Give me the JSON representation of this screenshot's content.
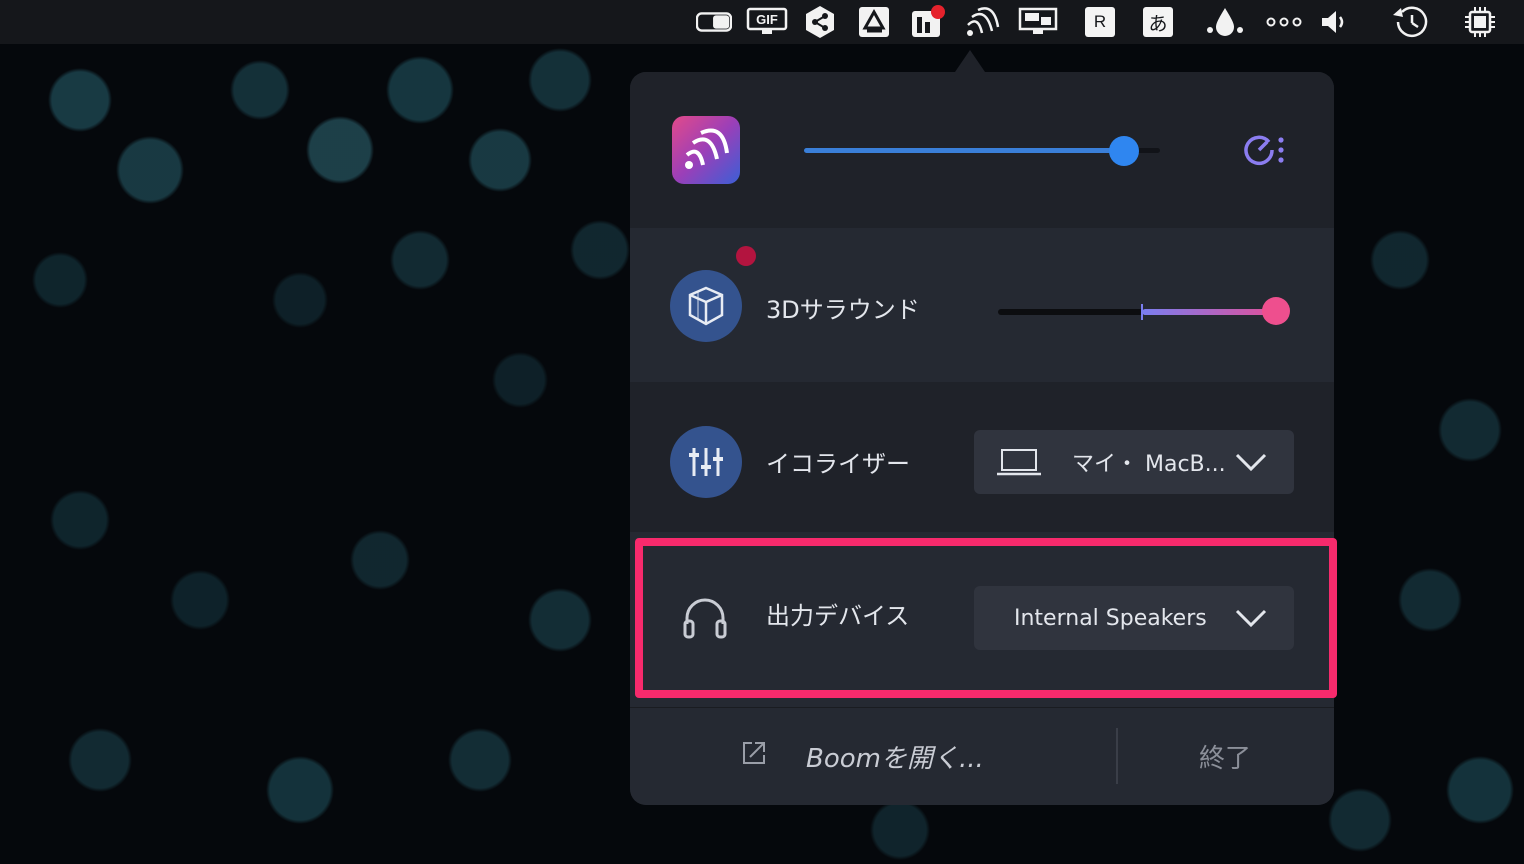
{
  "menubar": {
    "icons": [
      "toggle-icon",
      "gif-screen-icon",
      "share-hex-icon",
      "drive-icon",
      "notes-app-icon",
      "boom-icon",
      "display-icon",
      "r-icon",
      "japanese-input-icon",
      "droplet-icon",
      "more-dots-icon",
      "speaker-icon",
      "time-machine-icon",
      "cpu-icon"
    ],
    "r_label": "R",
    "input_label": "あ",
    "gif_label": "GIF"
  },
  "panel": {
    "volume_percent": 90,
    "surround": {
      "label": "3Dサラウンド",
      "value_percent": 100
    },
    "equalizer": {
      "label": "イコライザー",
      "preset": "マイ・ MacB..."
    },
    "output": {
      "label": "出力デバイス",
      "device": "Internal Speakers"
    },
    "footer": {
      "open_label": "Boomを開く...",
      "quit_label": "終了"
    }
  },
  "colors": {
    "accent_blue": "#2f86f0",
    "surround_pink": "#ee4f8e",
    "highlight": "#f72a6c"
  }
}
